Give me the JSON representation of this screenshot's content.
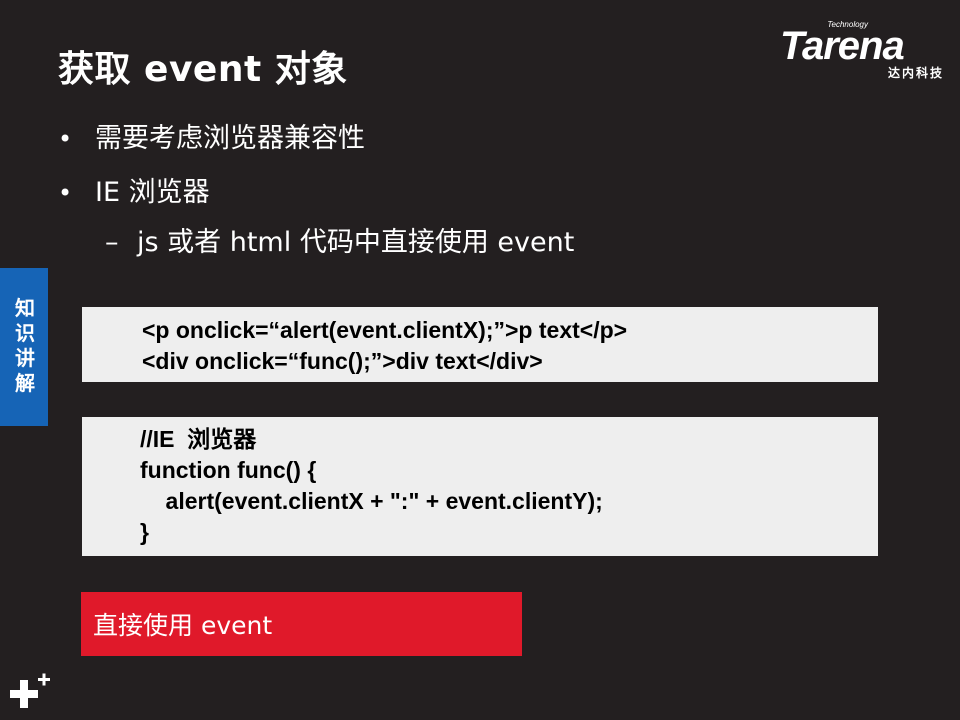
{
  "slide": {
    "title": "获取 event 对象",
    "bullets": [
      "需要考虑浏览器兼容性",
      "IE 浏览器"
    ],
    "bullet_symbol": "•",
    "sub_bullet_symbol": "–",
    "sub_bullet": "js 或者 html 代码中直接使用 event",
    "code_block_1": [
      "<p onclick=“alert(event.clientX);”>p text</p>",
      "<div onclick=“func();”>div text</div>"
    ],
    "code_block_2": [
      "//IE  浏览器",
      "function func() {",
      "    alert(event.clientX + \":\" + event.clientY);",
      "}"
    ],
    "callout": "直接使用 event"
  },
  "side_tab": [
    "知",
    "识",
    "讲",
    "解"
  ],
  "logo": {
    "tagline_top": "Technology",
    "wordmark": "Tarena",
    "tagline_bottom": "达内科技"
  },
  "colors": {
    "background": "#231f20",
    "side_tab": "#1664b6",
    "code_box": "#eeeeee",
    "callout": "#e0192a",
    "text": "#ffffff"
  },
  "icons": {
    "corner_mark": "plus-plus-icon"
  }
}
